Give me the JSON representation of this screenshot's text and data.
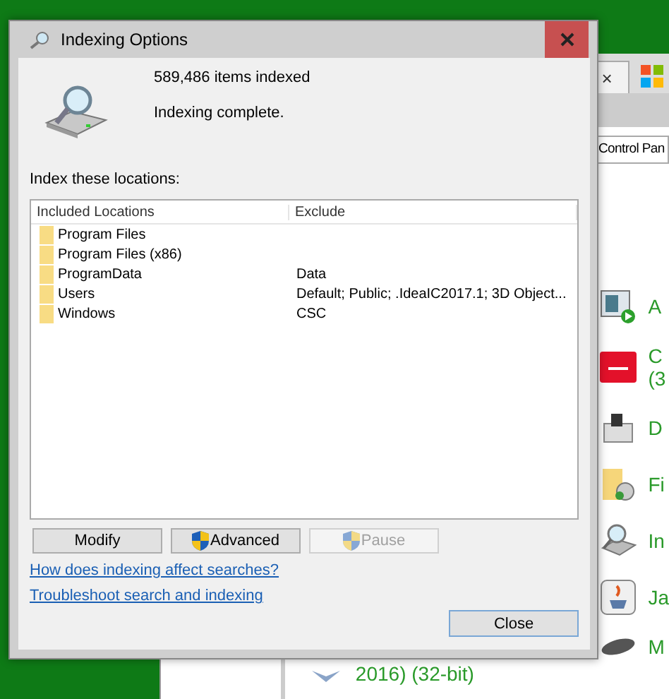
{
  "background_window": {
    "tab_close": "×",
    "address": "Control Pan",
    "items": [
      {
        "kind": "media",
        "lines": [
          "A"
        ]
      },
      {
        "kind": "red",
        "lines": [
          "C",
          "(3"
        ]
      },
      {
        "kind": "device",
        "lines": [
          "D"
        ]
      },
      {
        "kind": "folder",
        "lines": [
          "Fi"
        ]
      },
      {
        "kind": "search",
        "lines": [
          "In"
        ]
      },
      {
        "kind": "java",
        "lines": [
          "Ja"
        ]
      },
      {
        "kind": "mouse",
        "lines": [
          "M"
        ]
      }
    ],
    "bottom_item": "2016) (32-bit)"
  },
  "dialog": {
    "title": "Indexing Options",
    "items_count": "589,486 items indexed",
    "status": "Indexing complete.",
    "locations_label": "Index these locations:",
    "columns": [
      "Included Locations",
      "Exclude"
    ],
    "rows": [
      {
        "location": "Program Files"
      },
      {
        "location": "Program Files (x86)"
      },
      {
        "location": "ProgramData",
        "exclude": "Data"
      },
      {
        "location": "Users",
        "exclude": "Default; Public; .IdeaIC2017.1; 3D Object..."
      },
      {
        "location": "Windows",
        "exclude": "CSC"
      }
    ],
    "buttons": [
      {
        "label": "Modify",
        "shield": false,
        "disabled": false
      },
      {
        "label": "Advanced",
        "shield": true,
        "disabled": false
      },
      {
        "label": "Pause",
        "shield": true,
        "disabled": true
      }
    ],
    "links": [
      "How does indexing affect searches?",
      "Troubleshoot search and indexing"
    ],
    "close_button": "Close"
  }
}
